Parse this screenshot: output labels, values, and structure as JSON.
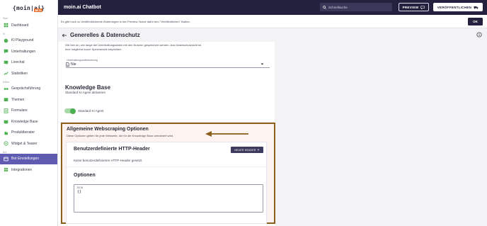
{
  "colors": {
    "topbar_bg": "#24213f",
    "active_nav_bg": "#5e5bb0",
    "highlight_border": "#8b5e1a",
    "toggle_on": "#4caf50",
    "logo_badge": "#e76a2b"
  },
  "sidebar": {
    "logo": "{moin|ai}",
    "logo_badge": "BETA",
    "sections": [
      {
        "label": "Start",
        "items": [
          {
            "label": "Dashboard",
            "icon": "dashboard-icon"
          }
        ]
      },
      {
        "label": "KI",
        "items": [
          {
            "label": "KI Playground",
            "icon": "ai-playground-icon"
          },
          {
            "label": "Unterhaltungen",
            "icon": "conversations-icon"
          },
          {
            "label": "Livechat",
            "icon": "livechat-icon"
          },
          {
            "label": "Statistiken",
            "icon": "statistics-icon"
          }
        ]
      },
      {
        "label": "Editor",
        "items": [
          {
            "label": "Gesprächsführung",
            "icon": "dialog-icon"
          },
          {
            "label": "Themen",
            "icon": "topics-icon"
          },
          {
            "label": "Formulare",
            "icon": "forms-icon"
          },
          {
            "label": "Knowledge Base",
            "icon": "knowledge-icon"
          },
          {
            "label": "Produktberater",
            "icon": "product-advisor-icon"
          },
          {
            "label": "Widget & Teaser",
            "icon": "widget-icon"
          }
        ]
      },
      {
        "label": "Bot",
        "items": [
          {
            "label": "Bot Einstellungen",
            "icon": "bot-settings-icon",
            "active": true
          },
          {
            "label": "Integrationen",
            "icon": "integrations-icon"
          }
        ]
      }
    ]
  },
  "topbar": {
    "title": "moin.ai Chatbot",
    "search_placeholder": "Schnellsuche",
    "preview_label": "PREVIEW",
    "publish_label": "VERÖFFENTLICHEN"
  },
  "notice": {
    "text": "Es gibt noch zu veröffentlichende Änderungen in der Preview. Nutze dafür den \"Veröffentlichen\" Button.",
    "ok_label": "OK"
  },
  "page": {
    "title": "Generelles & Datenschutz",
    "retention_description": "Gib hier an, wie lange die Unterhaltungsdaten mit den Nutzern gespeichert werden. Aus Datenschutzsicht ist eine möglichst kurze Speicherzeit empfohlen.",
    "retention_select_label": "Unterhaltungsaufbewahrung",
    "retention_select_value": "Nie",
    "knowledge_base_title": "Knowledge Base",
    "knowledge_base_subtitle": "Standard KI Agent aktivieren",
    "toggle_label": "Standard KI Agent",
    "toggle_on": true
  },
  "webscraping": {
    "title": "Allgemeine Webscraping Optionen",
    "subtitle": "Diese Optionen gelten für jede Webseite, die für die Knowledge Base untrainiert wird.",
    "http_title": "Benutzerdefinierte HTTP-Header",
    "new_header_label": "NEUER HEADER",
    "http_empty": "Keine benutzerdefinierten HTTP-Header gesetzt.",
    "options_title": "Optionen",
    "json_label": "JSON",
    "json_value": "{}"
  }
}
